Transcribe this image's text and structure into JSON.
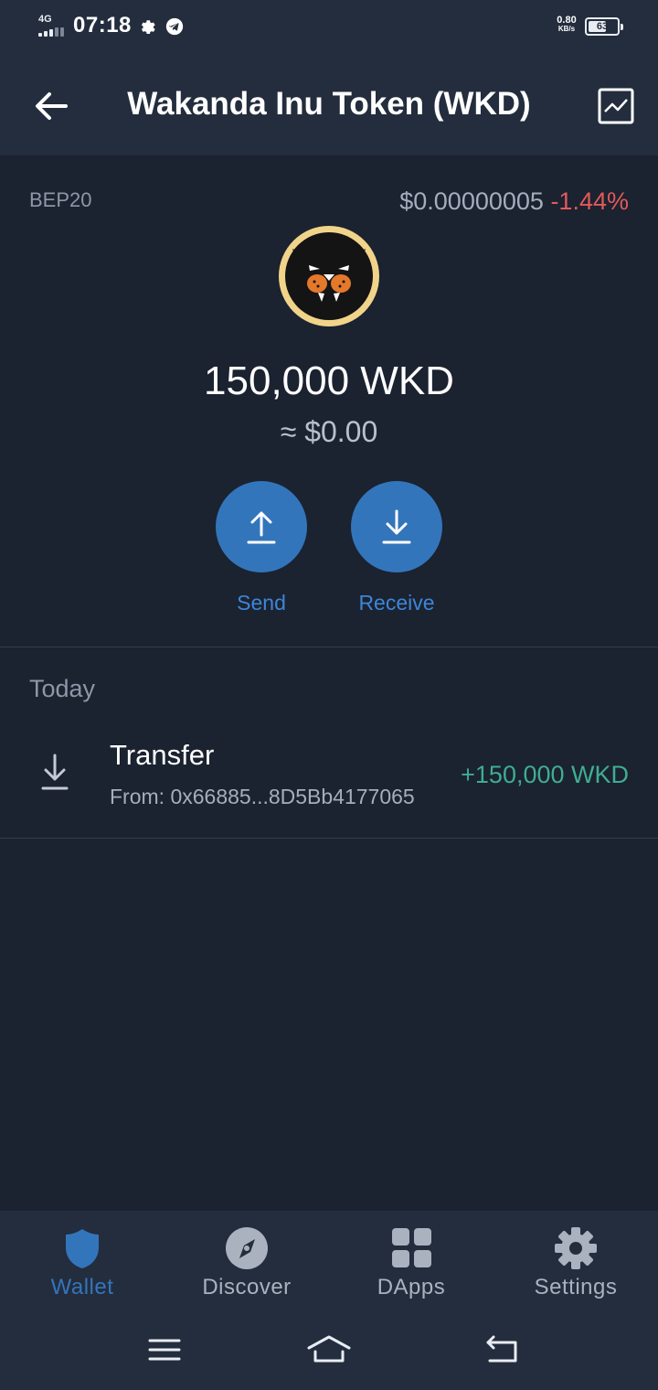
{
  "status_bar": {
    "network": "4G",
    "time": "07:18",
    "speed_value": "0.80",
    "speed_unit": "KB/s",
    "battery_level": "63",
    "battery_fraction": 0.63
  },
  "header": {
    "title": "Wakanda Inu Token (WKD)",
    "back_icon": "arrow-left-icon",
    "chart_icon": "line-chart-icon"
  },
  "token": {
    "standard": "BEP20",
    "price": "$0.00000005",
    "change": "-1.44%",
    "balance": "150,000 WKD",
    "fiat_value": "≈ $0.00"
  },
  "actions": {
    "send_label": "Send",
    "receive_label": "Receive"
  },
  "history": {
    "section_label": "Today",
    "transactions": [
      {
        "title": "Transfer",
        "subtitle": "From: 0x66885...8D5Bb4177065",
        "amount": "+150,000 WKD",
        "icon": "download-arrow-icon"
      }
    ]
  },
  "tabs": [
    {
      "label": "Wallet",
      "icon": "shield-icon",
      "active": true
    },
    {
      "label": "Discover",
      "icon": "compass-icon",
      "active": false
    },
    {
      "label": "DApps",
      "icon": "grid-icon",
      "active": false
    },
    {
      "label": "Settings",
      "icon": "gear-icon",
      "active": false
    }
  ],
  "colors": {
    "background": "#1b2230",
    "header": "#232d3d",
    "accent_blue": "#3375bb",
    "negative_red": "#e05a5a",
    "positive_green": "#3fad91"
  }
}
